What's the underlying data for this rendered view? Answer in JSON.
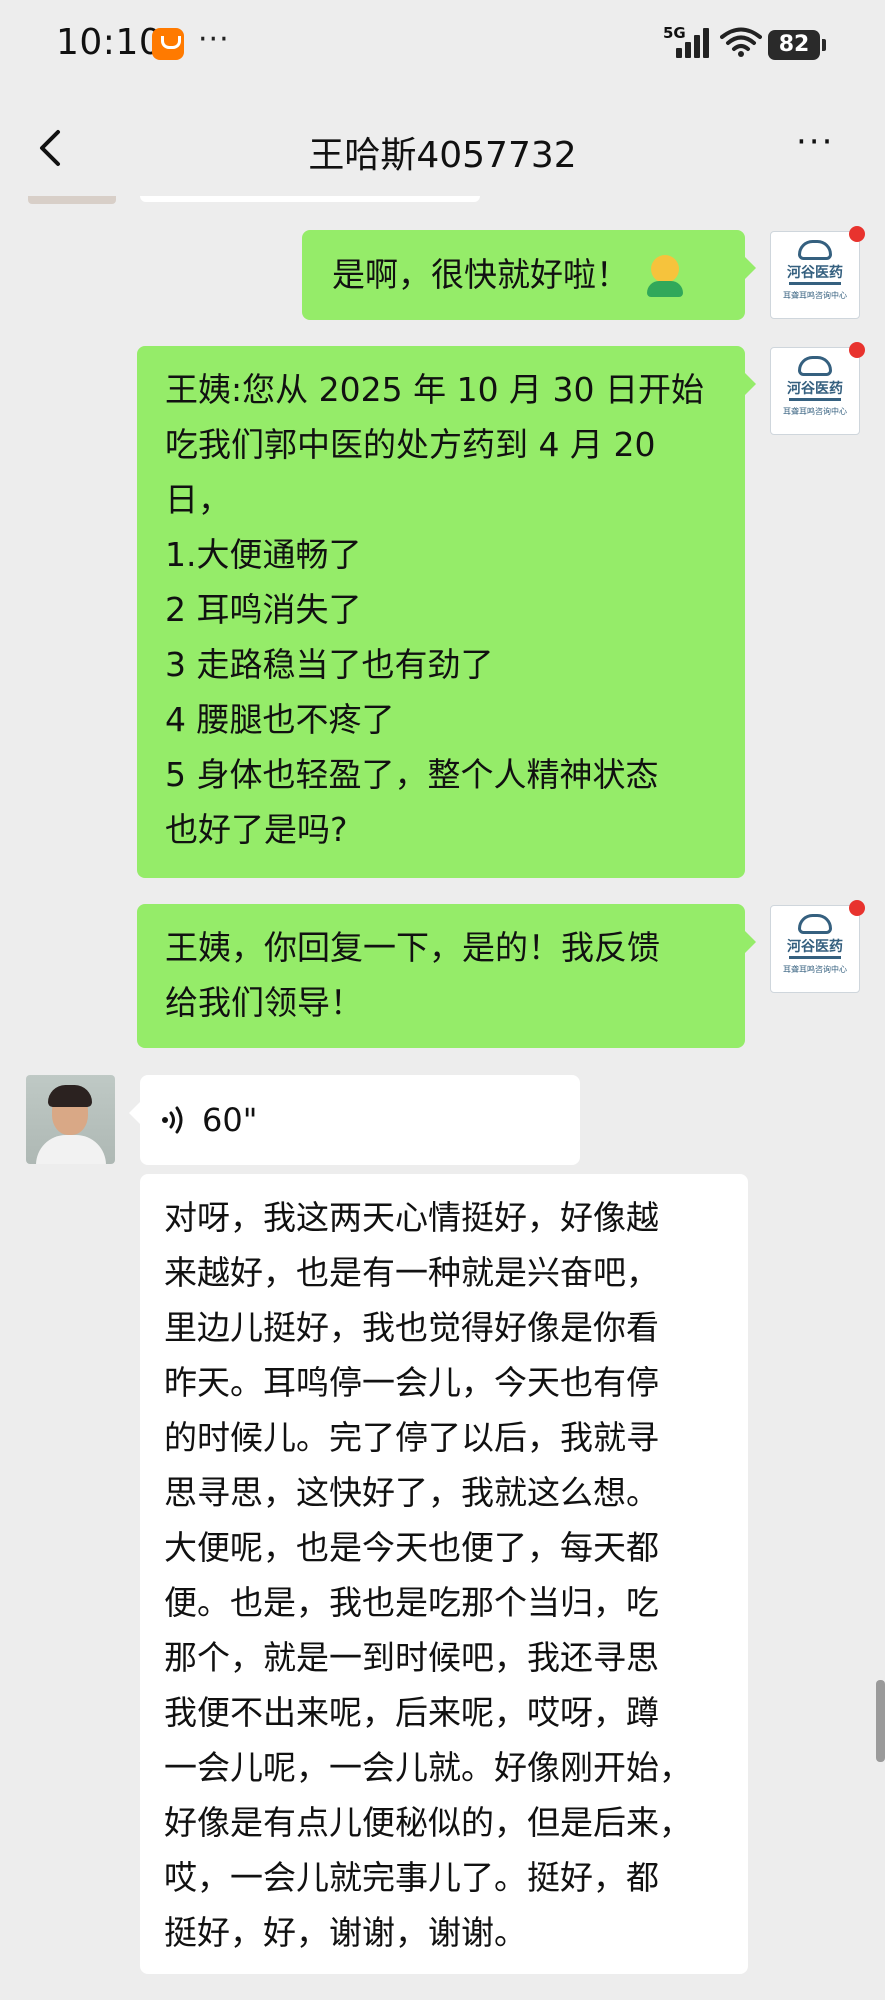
{
  "status_bar": {
    "time": "10:10",
    "more": "···",
    "network": "5G",
    "battery": "82",
    "icons": [
      "taobao-notification-icon",
      "signal-icon",
      "wifi-icon",
      "battery-icon"
    ]
  },
  "header": {
    "title": "王哈斯4057732",
    "back_icon": "chevron-left-icon",
    "menu": "···"
  },
  "colors": {
    "background": "#ededed",
    "sent_bubble": "#95ec69",
    "received_bubble": "#ffffff",
    "badge": "#e8332e"
  },
  "messages": [
    {
      "direction": "sent",
      "lines": [
        "是啊，很快就好啦！"
      ],
      "emoji": "person-emoji-icon",
      "avatar_logo": "河谷医药",
      "avatar_sub": "耳聋耳鸣咨询中心"
    },
    {
      "direction": "sent",
      "lines": [
        "王姨:您从 2025 年 10 月 30 日开始",
        "吃我们郭中医的处方药到 4 月 20",
        "日，",
        "1.大便通畅了",
        "2 耳鸣消失了",
        "3 走路稳当了也有劲了",
        "4 腰腿也不疼了",
        "5 身体也轻盈了，整个人精神状态",
        "也好了是吗?"
      ],
      "avatar_logo": "河谷医药",
      "avatar_sub": "耳聋耳鸣咨询中心"
    },
    {
      "direction": "sent",
      "lines": [
        "王姨，你回复一下，是的！我反馈",
        "给我们领导！"
      ],
      "avatar_logo": "河谷医药",
      "avatar_sub": "耳聋耳鸣咨询中心"
    },
    {
      "direction": "received",
      "type": "voice",
      "duration": "60\""
    },
    {
      "direction": "received",
      "type": "transcript",
      "lines": [
        "对呀，我这两天心情挺好，好像越",
        "来越好，也是有一种就是兴奋吧，",
        "里边儿挺好，我也觉得好像是你看",
        "昨天。耳鸣停一会儿，今天也有停",
        "的时候儿。完了停了以后，我就寻",
        "思寻思，这快好了，我就这么想。",
        "大便呢，也是今天也便了，每天都",
        "便。也是，我也是吃那个当归，吃",
        "那个，就是一到时候吧，我还寻思",
        "我便不出来呢，后来呢，哎呀，蹲",
        "一会儿呢，一会儿就。好像刚开始，",
        "好像是有点儿便秘似的，但是后来，",
        "哎，一会儿就完事儿了。挺好，都",
        "挺好，好，谢谢，谢谢。"
      ]
    }
  ]
}
